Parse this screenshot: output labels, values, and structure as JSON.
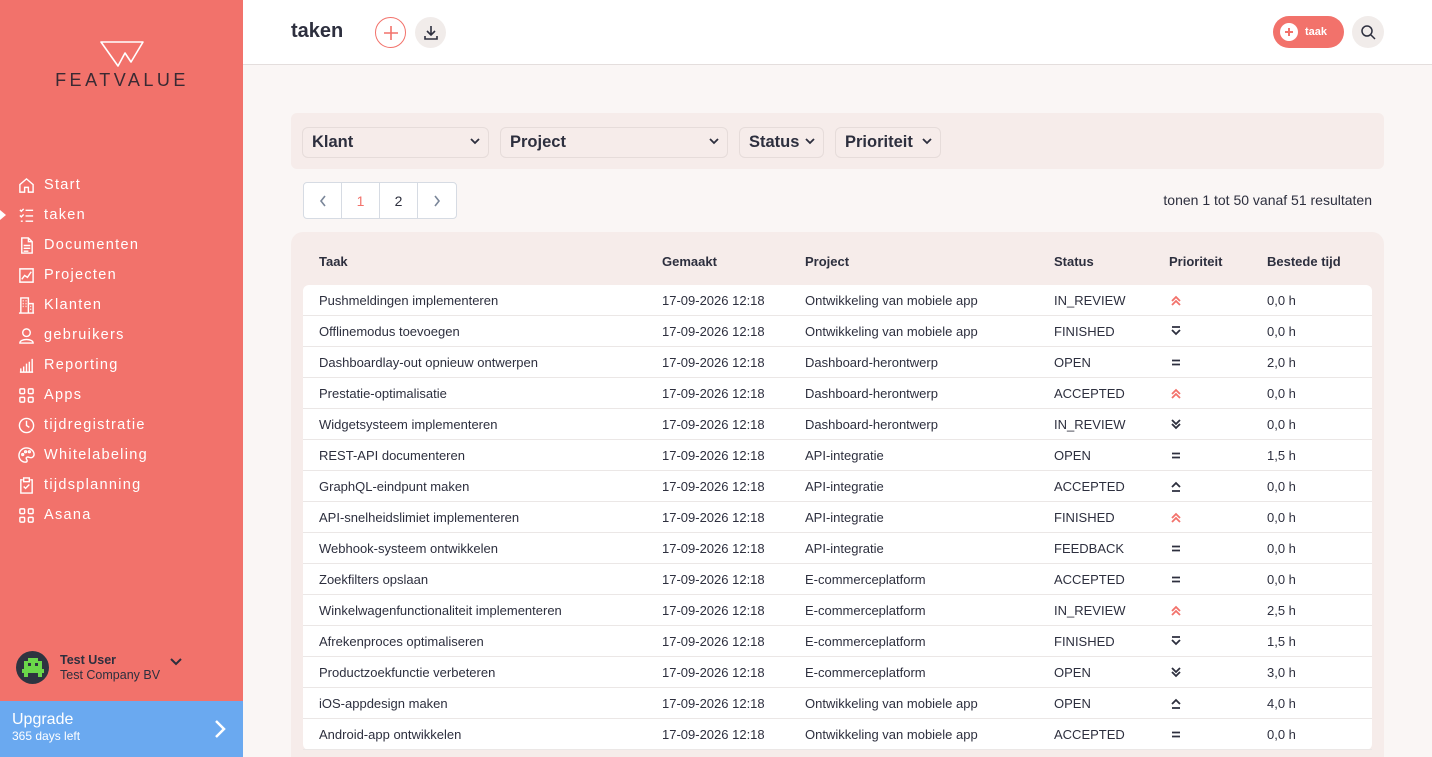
{
  "brand": {
    "name": "FEATVALUE",
    "accent": "#f2726b",
    "upgrade_color": "#6aa9f0"
  },
  "sidebar": {
    "items": [
      {
        "label": "Start",
        "icon": "home-icon"
      },
      {
        "label": "taken",
        "icon": "tasks-icon",
        "active": true
      },
      {
        "label": "Documenten",
        "icon": "document-icon"
      },
      {
        "label": "Projecten",
        "icon": "chart-icon"
      },
      {
        "label": "Klanten",
        "icon": "building-icon"
      },
      {
        "label": "gebruikers",
        "icon": "user-icon"
      },
      {
        "label": "Reporting",
        "icon": "bar-chart-icon"
      },
      {
        "label": "Apps",
        "icon": "apps-icon"
      },
      {
        "label": "tijdregistratie",
        "icon": "clock-icon"
      },
      {
        "label": "Whitelabeling",
        "icon": "palette-icon"
      },
      {
        "label": "tijdsplanning",
        "icon": "clipboard-icon"
      },
      {
        "label": "Asana",
        "icon": "apps-icon"
      }
    ],
    "user": {
      "name": "Test User",
      "company": "Test Company BV"
    },
    "upgrade": {
      "title": "Upgrade",
      "subtitle": "365 days left"
    }
  },
  "header": {
    "title": "taken",
    "new_task_label": "taak"
  },
  "filters": {
    "klant": "Klant",
    "project": "Project",
    "status": "Status",
    "prioriteit": "Prioriteit"
  },
  "pagination": {
    "pages": [
      "1",
      "2"
    ],
    "current": "1",
    "results_text": "tonen 1 tot 50 vanaf 51 resultaten"
  },
  "table": {
    "columns": {
      "taak": "Taak",
      "gemaakt": "Gemaakt",
      "project": "Project",
      "status": "Status",
      "prioriteit": "Prioriteit",
      "tijd": "Bestede tijd"
    },
    "rows": [
      {
        "taak": "Pushmeldingen implementeren",
        "gemaakt": "17-09-2026 12:18",
        "project": "Ontwikkeling van mobiele app",
        "status": "IN_REVIEW",
        "prioriteit": "highest",
        "tijd": "0,0 h"
      },
      {
        "taak": "Offlinemodus toevoegen",
        "gemaakt": "17-09-2026 12:18",
        "project": "Ontwikkeling van mobiele app",
        "status": "FINISHED",
        "prioriteit": "lowest",
        "tijd": "0,0 h"
      },
      {
        "taak": "Dashboardlay-out opnieuw ontwerpen",
        "gemaakt": "17-09-2026 12:18",
        "project": "Dashboard-herontwerp",
        "status": "OPEN",
        "prioriteit": "medium",
        "tijd": "2,0 h"
      },
      {
        "taak": "Prestatie-optimalisatie",
        "gemaakt": "17-09-2026 12:18",
        "project": "Dashboard-herontwerp",
        "status": "ACCEPTED",
        "prioriteit": "highest",
        "tijd": "0,0 h"
      },
      {
        "taak": "Widgetsysteem implementeren",
        "gemaakt": "17-09-2026 12:18",
        "project": "Dashboard-herontwerp",
        "status": "IN_REVIEW",
        "prioriteit": "low",
        "tijd": "0,0 h"
      },
      {
        "taak": "REST-API documenteren",
        "gemaakt": "17-09-2026 12:18",
        "project": "API-integratie",
        "status": "OPEN",
        "prioriteit": "medium",
        "tijd": "1,5 h"
      },
      {
        "taak": "GraphQL-eindpunt maken",
        "gemaakt": "17-09-2026 12:18",
        "project": "API-integratie",
        "status": "ACCEPTED",
        "prioriteit": "high",
        "tijd": "0,0 h"
      },
      {
        "taak": "API-snelheidslimiet implementeren",
        "gemaakt": "17-09-2026 12:18",
        "project": "API-integratie",
        "status": "FINISHED",
        "prioriteit": "highest",
        "tijd": "0,0 h"
      },
      {
        "taak": "Webhook-systeem ontwikkelen",
        "gemaakt": "17-09-2026 12:18",
        "project": "API-integratie",
        "status": "FEEDBACK",
        "prioriteit": "medium",
        "tijd": "0,0 h"
      },
      {
        "taak": "Zoekfilters opslaan",
        "gemaakt": "17-09-2026 12:18",
        "project": "E-commerceplatform",
        "status": "ACCEPTED",
        "prioriteit": "medium",
        "tijd": "0,0 h"
      },
      {
        "taak": "Winkelwagenfunctionaliteit implementeren",
        "gemaakt": "17-09-2026 12:18",
        "project": "E-commerceplatform",
        "status": "IN_REVIEW",
        "prioriteit": "highest",
        "tijd": "2,5 h"
      },
      {
        "taak": "Afrekenproces optimaliseren",
        "gemaakt": "17-09-2026 12:18",
        "project": "E-commerceplatform",
        "status": "FINISHED",
        "prioriteit": "lowest",
        "tijd": "1,5 h"
      },
      {
        "taak": "Productzoekfunctie verbeteren",
        "gemaakt": "17-09-2026 12:18",
        "project": "E-commerceplatform",
        "status": "OPEN",
        "prioriteit": "low",
        "tijd": "3,0 h"
      },
      {
        "taak": "iOS-appdesign maken",
        "gemaakt": "17-09-2026 12:18",
        "project": "Ontwikkeling van mobiele app",
        "status": "OPEN",
        "prioriteit": "high",
        "tijd": "4,0 h"
      },
      {
        "taak": "Android-app ontwikkelen",
        "gemaakt": "17-09-2026 12:18",
        "project": "Ontwikkeling van mobiele app",
        "status": "ACCEPTED",
        "prioriteit": "medium",
        "tijd": "0,0 h"
      }
    ]
  }
}
